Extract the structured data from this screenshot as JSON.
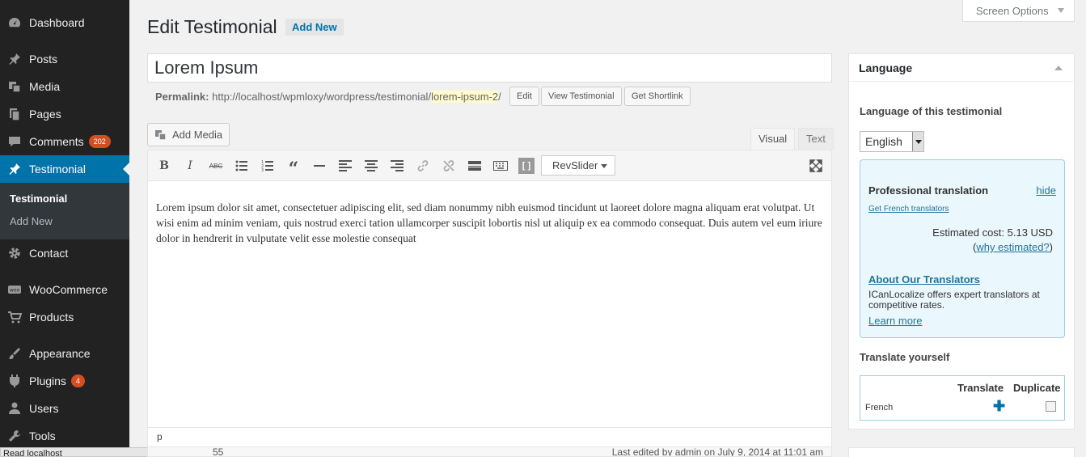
{
  "sidebar": {
    "items": [
      {
        "label": "Dashboard",
        "icon": "dashboard-icon"
      },
      {
        "label": "Posts",
        "icon": "pin-icon"
      },
      {
        "label": "Media",
        "icon": "media-icon"
      },
      {
        "label": "Pages",
        "icon": "pages-icon"
      },
      {
        "label": "Comments",
        "icon": "comments-icon",
        "badge": "202"
      },
      {
        "label": "Testimonial",
        "icon": "pin-icon"
      },
      {
        "label": "Contact",
        "icon": "gear-icon"
      },
      {
        "label": "WooCommerce",
        "icon": "woo-icon"
      },
      {
        "label": "Products",
        "icon": "cart-icon"
      },
      {
        "label": "Appearance",
        "icon": "brush-icon"
      },
      {
        "label": "Plugins",
        "icon": "plug-icon",
        "badge": "4"
      },
      {
        "label": "Users",
        "icon": "user-icon"
      },
      {
        "label": "Tools",
        "icon": "wrench-icon"
      }
    ],
    "submenu": [
      "Testimonial",
      "Add New"
    ],
    "status_tip": "Read localhost"
  },
  "header": {
    "title": "Edit Testimonial",
    "add_new": "Add New",
    "screen_options": "Screen Options"
  },
  "post": {
    "title": "Lorem Ipsum",
    "permalink_label": "Permalink:",
    "permalink_base": "http://localhost/wpmloxy/wordpress/testimonial/",
    "permalink_slug": "lorem-ipsum-2",
    "permalink_end": "/",
    "buttons": {
      "edit": "Edit",
      "view": "View Testimonial",
      "shortlink": "Get Shortlink"
    }
  },
  "editor": {
    "add_media": "Add Media",
    "tabs": {
      "visual": "Visual",
      "text": "Text"
    },
    "revslider": "RevSlider",
    "content": "Lorem ipsum dolor sit amet, consectetuer adipiscing elit, sed diam nonummy nibh euismod tincidunt ut laoreet dolore magna aliquam erat volutpat. Ut wisi enim ad minim veniam, quis nostrud exerci tation ullamcorper suscipit lobortis nisl ut aliquip ex ea commodo consequat. Duis autem vel eum iriure dolor in hendrerit in vulputate velit esse molestie consequat",
    "path": "p",
    "word_count_partial": "55",
    "last_edited": "Last edited by admin on July 9, 2014 at 11:01 am"
  },
  "language_box": {
    "title": "Language",
    "label": "Language of this testimonial",
    "selected": "English",
    "pro": {
      "title": "Professional translation",
      "hide": "hide",
      "get_french": "Get French translators",
      "cost": "Estimated cost: 5.13 USD",
      "why": "why estimated?",
      "about": "About Our Translators",
      "desc": "ICanLocalize offers expert translators at competitive rates.",
      "learn": "Learn more"
    },
    "translate_yourself": "Translate yourself",
    "table": {
      "col_translate": "Translate",
      "col_duplicate": "Duplicate",
      "row_lang": "French"
    }
  },
  "colors": {
    "accent": "#0073aa",
    "sidebar": "#222222",
    "badge": "#d54e21"
  }
}
